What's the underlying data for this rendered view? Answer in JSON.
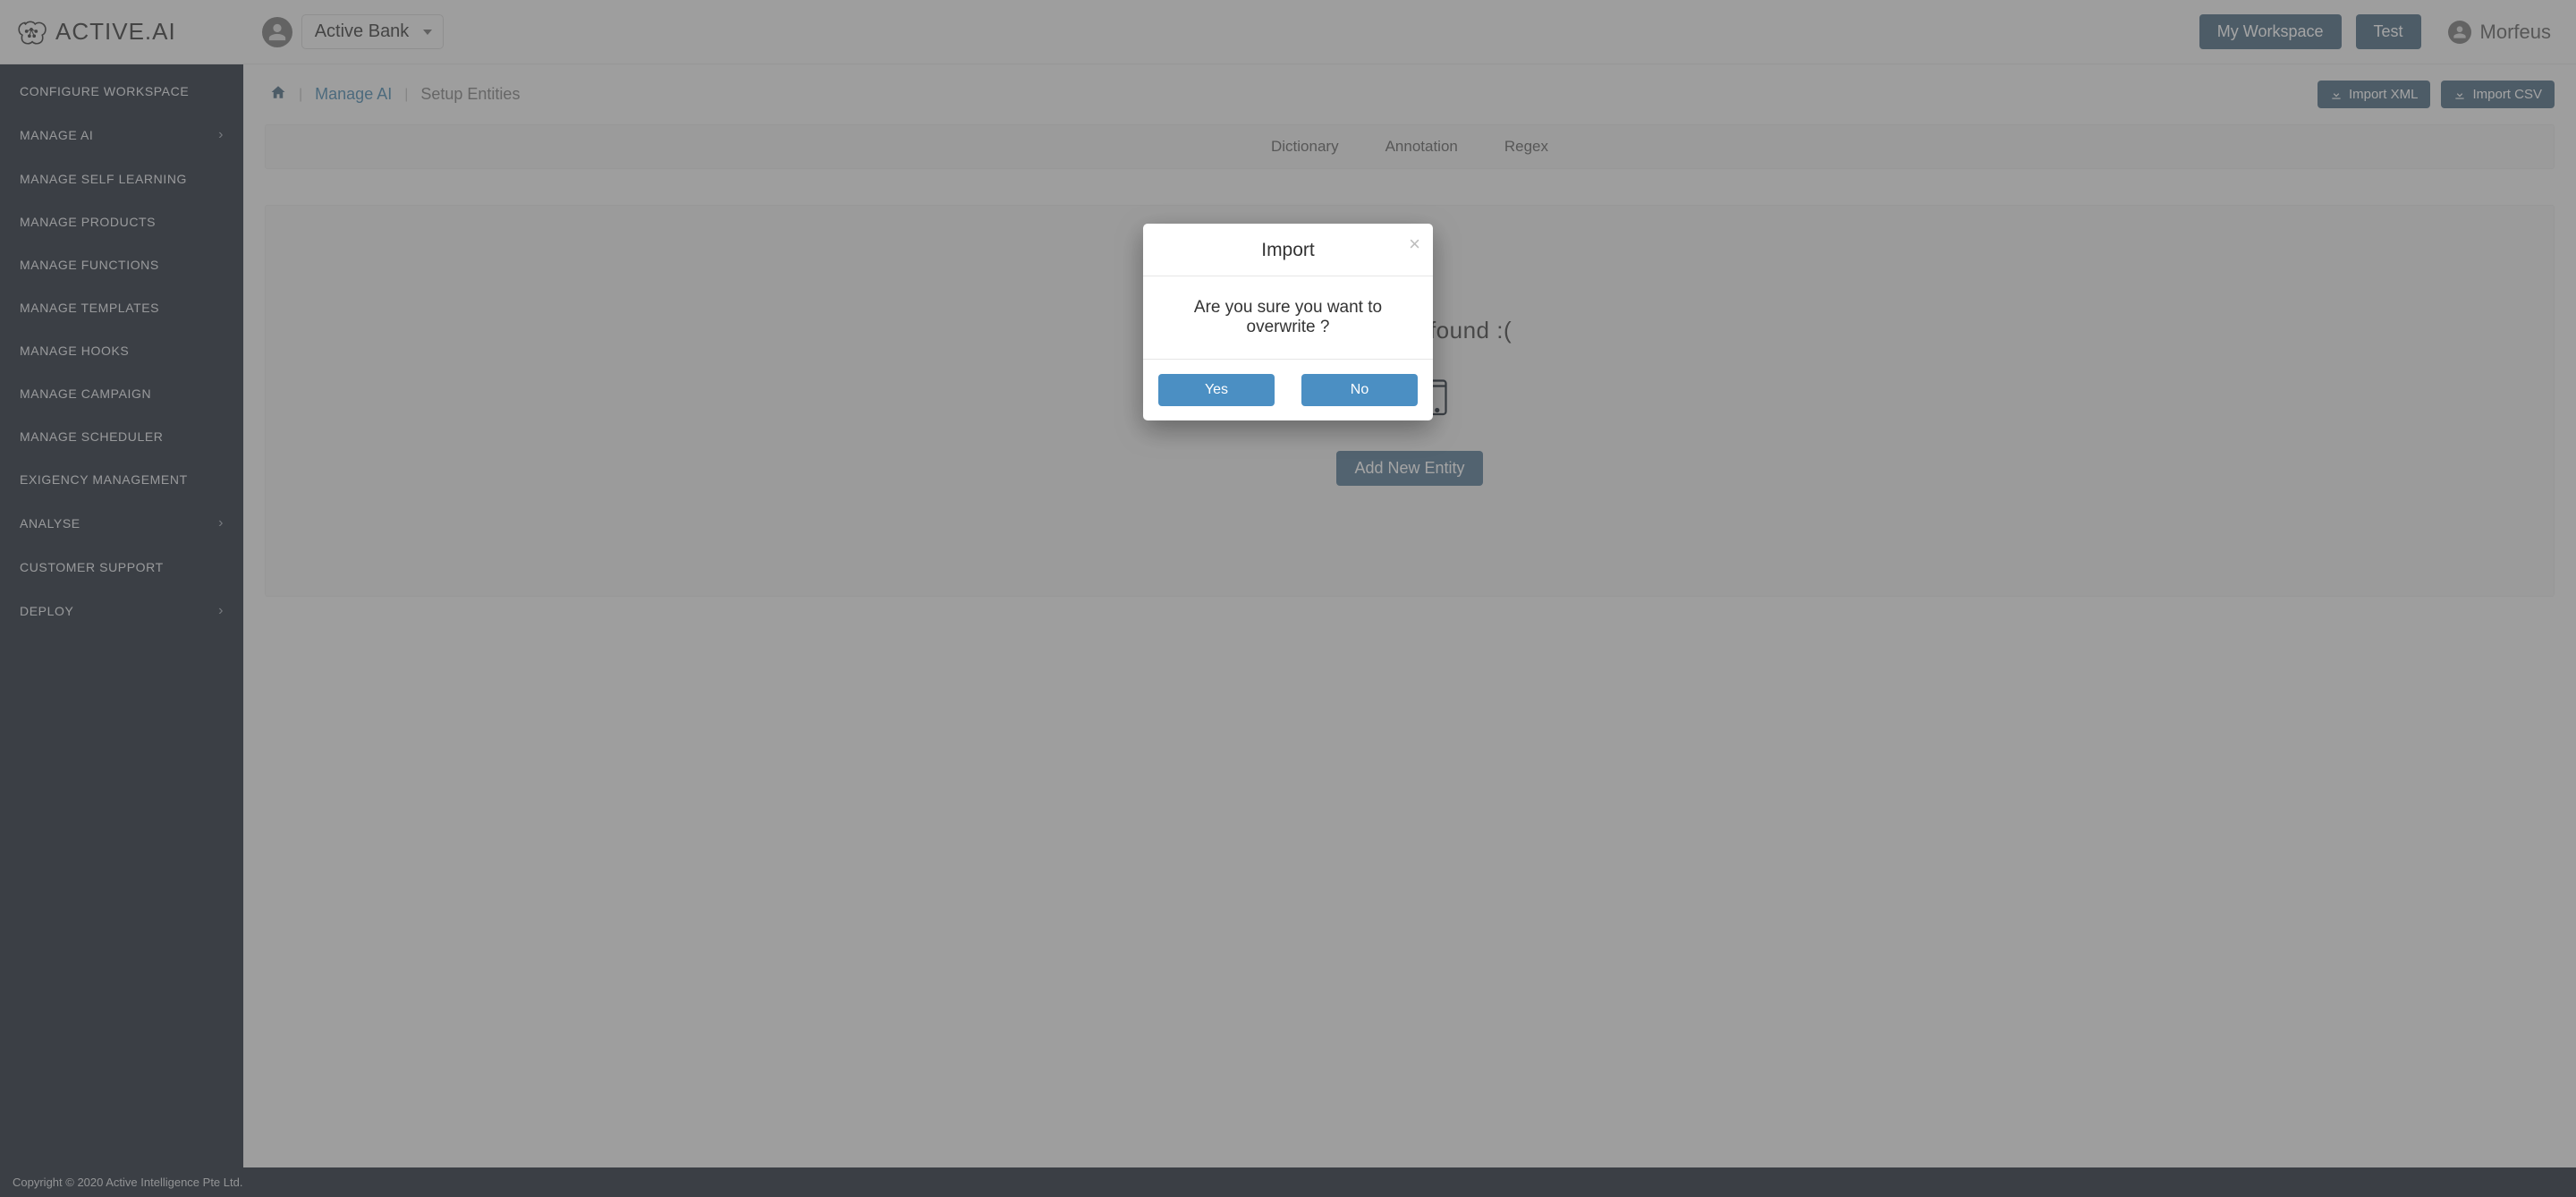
{
  "brand": {
    "name": "ACTIVE.AI"
  },
  "workspace": {
    "selected": "Active Bank"
  },
  "topbar": {
    "my_workspace": "My Workspace",
    "test": "Test",
    "username": "Morfeus"
  },
  "sidebar": {
    "items": [
      {
        "label": "Configure Workspace",
        "expandable": false
      },
      {
        "label": "Manage AI",
        "expandable": true
      },
      {
        "label": "Manage Self Learning",
        "expandable": false
      },
      {
        "label": "Manage Products",
        "expandable": false
      },
      {
        "label": "Manage Functions",
        "expandable": false
      },
      {
        "label": "Manage Templates",
        "expandable": false
      },
      {
        "label": "Manage Hooks",
        "expandable": false
      },
      {
        "label": "Manage Campaign",
        "expandable": false
      },
      {
        "label": "Manage Scheduler",
        "expandable": false
      },
      {
        "label": "Exigency Management",
        "expandable": false
      },
      {
        "label": "Analyse",
        "expandable": true
      },
      {
        "label": "Customer Support",
        "expandable": false
      },
      {
        "label": "Deploy",
        "expandable": true
      }
    ]
  },
  "breadcrumb": {
    "link": "Manage AI",
    "current": "Setup Entities"
  },
  "actions": {
    "import_xml": "Import XML",
    "import_csv": "Import CSV"
  },
  "tabs": {
    "items": [
      "Dictionary",
      "Annotation",
      "Regex"
    ]
  },
  "empty": {
    "title": "No entities found :(",
    "add_button": "Add New Entity"
  },
  "modal": {
    "title": "Import",
    "body": "Are you sure you want to overwrite ?",
    "yes": "Yes",
    "no": "No"
  },
  "footer": {
    "copyright": "Copyright © 2020 Active Intelligence Pte Ltd."
  }
}
